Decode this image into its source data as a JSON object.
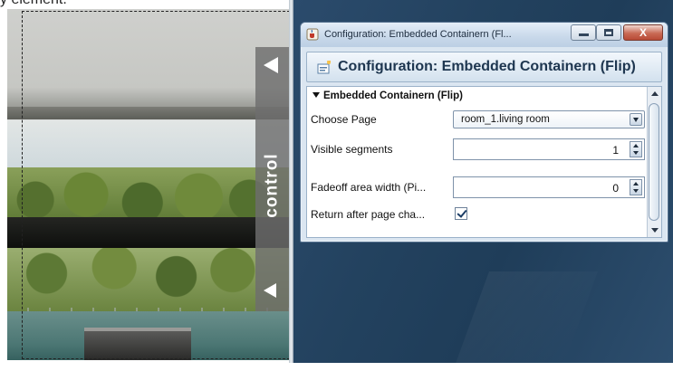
{
  "caption": "y element.",
  "photo": {
    "control_label": "control"
  },
  "window": {
    "title": "Configuration: Embedded Containern (Fl...",
    "header": "Configuration: Embedded Containern (Flip)",
    "close_glyph": "X",
    "section": "Embedded Containern (Flip)",
    "rows": {
      "choose_page": {
        "label": "Choose Page",
        "value": "room_1.living room"
      },
      "visible_segments": {
        "label": "Visible segments",
        "value": "1"
      },
      "fadeoff": {
        "label": "Fadeoff area width (Pi...",
        "value": "0"
      },
      "return_after": {
        "label": "Return after page cha...",
        "checked": true
      }
    }
  },
  "colors": {
    "desktop": "#23425f",
    "title_bar": "#c8d8ea",
    "close_button": "#c96a55"
  },
  "icons": [
    "java-cup-icon",
    "configuration-icon",
    "minimize-icon",
    "maximize-icon",
    "close-icon",
    "arrow-left-icon",
    "dropdown-arrow-icon",
    "spinner-icon",
    "checkbox-icon"
  ]
}
